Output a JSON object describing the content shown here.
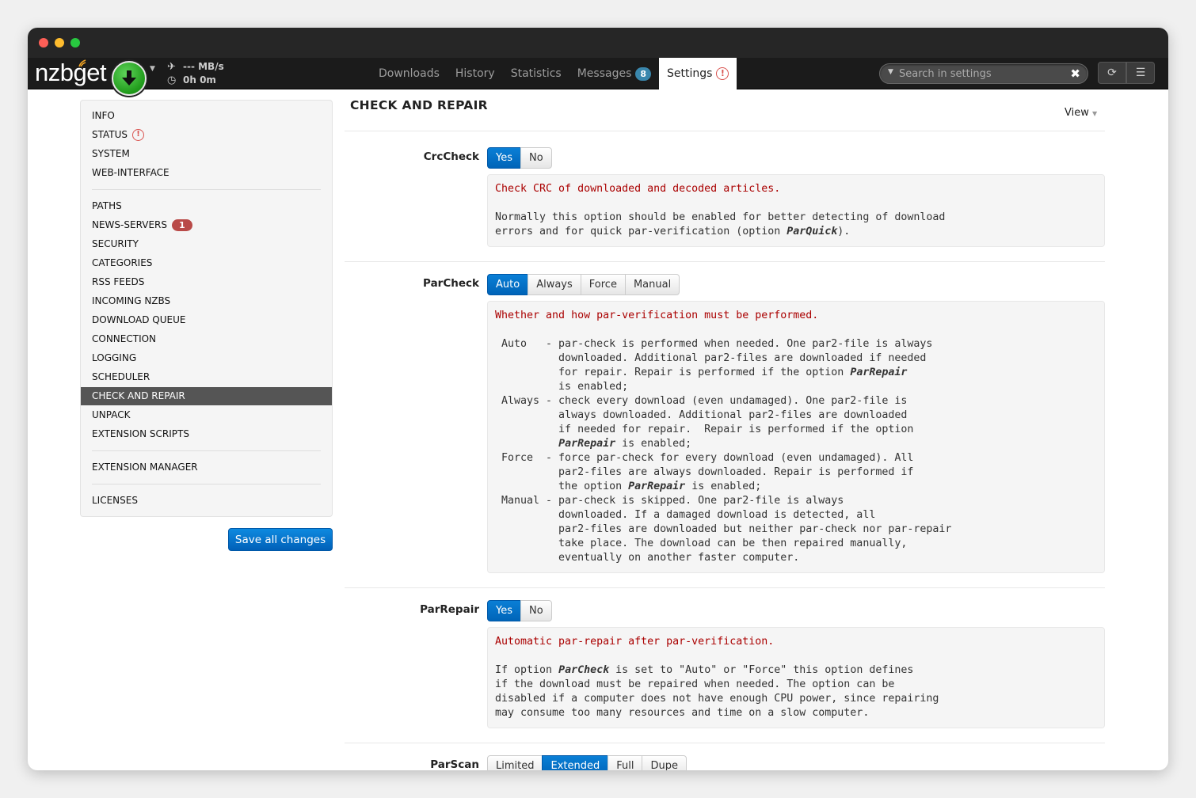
{
  "app": {
    "logo": "nzbget",
    "speed": "--- MB/s",
    "time": "0h 0m"
  },
  "tabs": [
    {
      "label": "Downloads"
    },
    {
      "label": "History"
    },
    {
      "label": "Statistics"
    },
    {
      "label": "Messages",
      "badge": "8"
    },
    {
      "label": "Settings"
    }
  ],
  "search": {
    "placeholder": "Search in settings"
  },
  "sidebar": {
    "items": [
      "INFO",
      "STATUS",
      "SYSTEM",
      "WEB-INTERFACE",
      "PATHS",
      "NEWS-SERVERS",
      "SECURITY",
      "CATEGORIES",
      "RSS FEEDS",
      "INCOMING NZBS",
      "DOWNLOAD QUEUE",
      "CONNECTION",
      "LOGGING",
      "SCHEDULER",
      "CHECK AND REPAIR",
      "UNPACK",
      "EXTENSION SCRIPTS",
      "EXTENSION MANAGER",
      "LICENSES"
    ],
    "news_servers_badge": "1",
    "save_label": "Save all changes"
  },
  "main": {
    "title": "CHECK AND REPAIR",
    "view_label": "View",
    "options": [
      {
        "name": "CrcCheck",
        "choices": [
          "Yes",
          "No"
        ],
        "selected": "Yes",
        "head": "Check CRC of downloaded and decoded articles.",
        "body_lines": [
          "Normally this option should be enabled for better detecting of download",
          "errors and for quick par-verification (option ParQuick)."
        ]
      },
      {
        "name": "ParCheck",
        "choices": [
          "Auto",
          "Always",
          "Force",
          "Manual"
        ],
        "selected": "Auto",
        "head": "Whether and how par-verification must be performed.",
        "body_lines": [
          " Auto   - par-check is performed when needed. One par2-file is always",
          "          downloaded. Additional par2-files are downloaded if needed",
          "          for repair. Repair is performed if the option ParRepair",
          "          is enabled;",
          " Always - check every download (even undamaged). One par2-file is",
          "          always downloaded. Additional par2-files are downloaded",
          "          if needed for repair.  Repair is performed if the option",
          "          ParRepair is enabled;",
          " Force  - force par-check for every download (even undamaged). All",
          "          par2-files are always downloaded. Repair is performed if",
          "          the option ParRepair is enabled;",
          " Manual - par-check is skipped. One par2-file is always",
          "          downloaded. If a damaged download is detected, all",
          "          par2-files are downloaded but neither par-check nor par-repair",
          "          take place. The download can be then repaired manually,",
          "          eventually on another faster computer."
        ]
      },
      {
        "name": "ParRepair",
        "choices": [
          "Yes",
          "No"
        ],
        "selected": "Yes",
        "head": "Automatic par-repair after par-verification.",
        "body_lines": [
          "If option ParCheck is set to \"Auto\" or \"Force\" this option defines",
          "if the download must be repaired when needed. The option can be",
          "disabled if a computer does not have enough CPU power, since repairing",
          "may consume too many resources and time on a slow computer."
        ]
      },
      {
        "name": "ParScan",
        "choices": [
          "Limited",
          "Extended",
          "Full",
          "Dupe"
        ],
        "selected": "Extended"
      }
    ]
  },
  "colors": {
    "accent": "#0064b8",
    "navbar": "#1b1b1b",
    "warning": "#d9534f",
    "badge_info": "#3a87ad",
    "badge_danger": "#b94a48",
    "desc_head": "#aa0000"
  }
}
